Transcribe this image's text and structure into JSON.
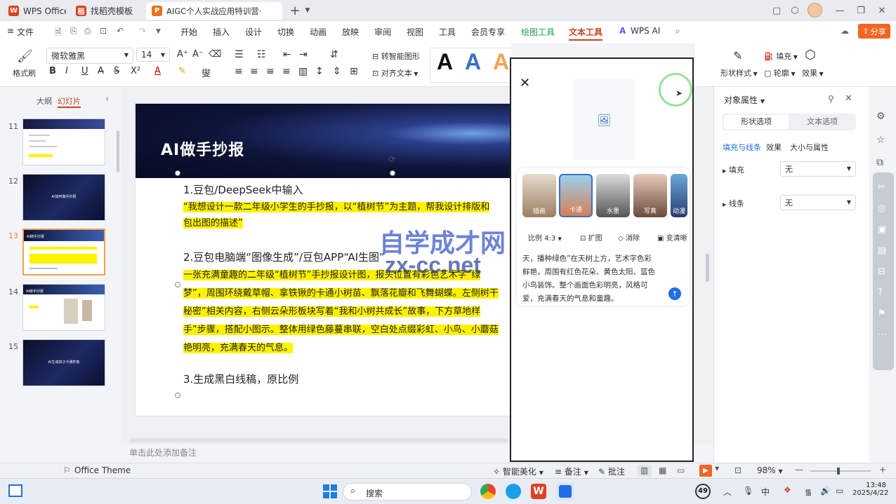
{
  "tabs": [
    {
      "label": "WPS Office",
      "icon": "W",
      "color": "#e0401f"
    },
    {
      "label": "找稻壳模板",
      "icon": "稻",
      "color": "#e0401f"
    },
    {
      "label": "AIGC个人实战应用特训营·",
      "icon": "P",
      "color": "#e8711c"
    }
  ],
  "menu": {
    "file": "文件",
    "items": [
      "开始",
      "插入",
      "设计",
      "切换",
      "动画",
      "放映",
      "审阅",
      "视图",
      "工具",
      "会员专享"
    ],
    "drawing_tools": "绘图工具",
    "text_tools": "文本工具",
    "wps_ai": "WPS AI",
    "share": "分享"
  },
  "ribbon": {
    "format_painter": "格式刷",
    "font_name": "微软雅黑",
    "font_size": "14",
    "smart_shape": "转智能图形",
    "align_text": "对齐文本",
    "fill": "填充",
    "outline": "轮廓",
    "shape_style": "形状样式",
    "effect": "效果"
  },
  "left_panel": {
    "outline_tab": "大纲",
    "slides_tab": "幻灯片",
    "slides": [
      {
        "num": "11",
        "title": ""
      },
      {
        "num": "12",
        "title": "AI如何做手抄报"
      },
      {
        "num": "13",
        "title": "AI做手抄报"
      },
      {
        "num": "14",
        "title": "AI做手抄报"
      },
      {
        "num": "15",
        "title": "AI生成孩子卡通形象"
      }
    ]
  },
  "slide": {
    "title": "AI做手抄报",
    "step1": "1.豆包/DeepSeek中输入",
    "prompt1_line1": "“我想设计一款二年级小学生的手抄报，以“植树节”为主题，帮我设计排版和",
    "prompt1_line2": "包出图的描述”",
    "step2": "2.豆包电脑端“图像生成”/豆包APP“AI生图”",
    "prompt2_lines": [
      "一张充满童趣的二年级“植树节”手抄报设计图，报头位置有彩色艺术字“绿",
      "梦”，周围环绕戴草帽、拿铁锹的卡通小树苗、飘落花瓣和飞舞蝴蝶。左侧树干",
      "秘密”相关内容，右侧云朵形板块写着“我和小树共成长”故事，下方草地样",
      "手”步骤，搭配小图示。整体用绿色藤蔓串联，空白处点缀彩虹、小鸟、小蘑菇",
      "艳明亮，充满春天的气息。"
    ],
    "step3": "3.生成黑白线稿，原比例",
    "notes": "单击此处添加备注"
  },
  "phone": {
    "styles": [
      "插画",
      "卡通",
      "水墨",
      "写真",
      "动漫"
    ],
    "ratio": "比例 4:3",
    "expand": "扩图",
    "erase": "消除",
    "hd": "变清晰",
    "prompt_lines": [
      "天，播种绿色”在天树上方，艺术字色彩",
      "鲜艳，周围有红色花朵、黄色太阳、蓝色",
      "小鸟装饰。整个画面色彩明亮，风格可",
      "爱，充满春天的气息和童趣。"
    ]
  },
  "watermark": {
    "line1": "自学成才网",
    "line2": "zx-cc.net"
  },
  "right_panel": {
    "title": "对象属性",
    "tab_shape": "形状选项",
    "tab_text": "文本选项",
    "sub_fill_line": "填充与线条",
    "sub_effect": "效果",
    "sub_size": "大小与属性",
    "fill_label": "填充",
    "fill_value": "无",
    "line_label": "线条",
    "line_value": "无"
  },
  "status": {
    "theme": "Office Theme",
    "smart": "智能美化",
    "notes": "备注",
    "comments": "批注",
    "zoom": "98%"
  },
  "taskbar": {
    "search": "搜索",
    "badge": "49",
    "time": "13:48",
    "date": "2025/4/22"
  }
}
